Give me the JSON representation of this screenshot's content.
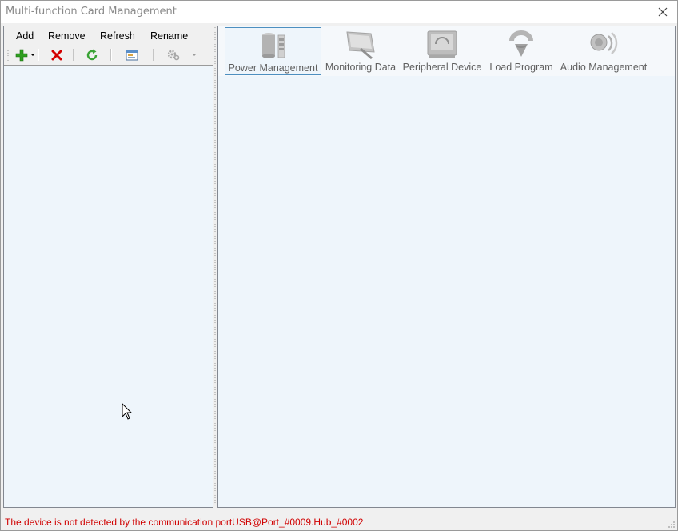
{
  "window": {
    "title": "Multi-function Card Management"
  },
  "left_menu": [
    {
      "label": "Add"
    },
    {
      "label": "Remove"
    },
    {
      "label": "Refresh"
    },
    {
      "label": "Rename"
    }
  ],
  "toolbar_icons": [
    "add-icon",
    "delete-icon",
    "refresh-icon",
    "rename-icon",
    "settings-icon"
  ],
  "ribbon": [
    {
      "label": "Power Management",
      "icon": "power-management-icon",
      "active": true
    },
    {
      "label": "Monitoring Data",
      "icon": "monitoring-data-icon",
      "active": false
    },
    {
      "label": "Peripheral Device",
      "icon": "peripheral-device-icon",
      "active": false
    },
    {
      "label": "Load Program",
      "icon": "load-program-icon",
      "active": false
    },
    {
      "label": "Audio Management",
      "icon": "audio-management-icon",
      "active": false
    }
  ],
  "status": {
    "message": "The device is not detected by the communication portUSB@Port_#0009.Hub_#0002",
    "color": "#d00000"
  },
  "colors": {
    "pane_background": "#eef5fb",
    "active_border": "#4d8fc0",
    "add_green": "#2e9e1f",
    "delete_red": "#d40000"
  }
}
